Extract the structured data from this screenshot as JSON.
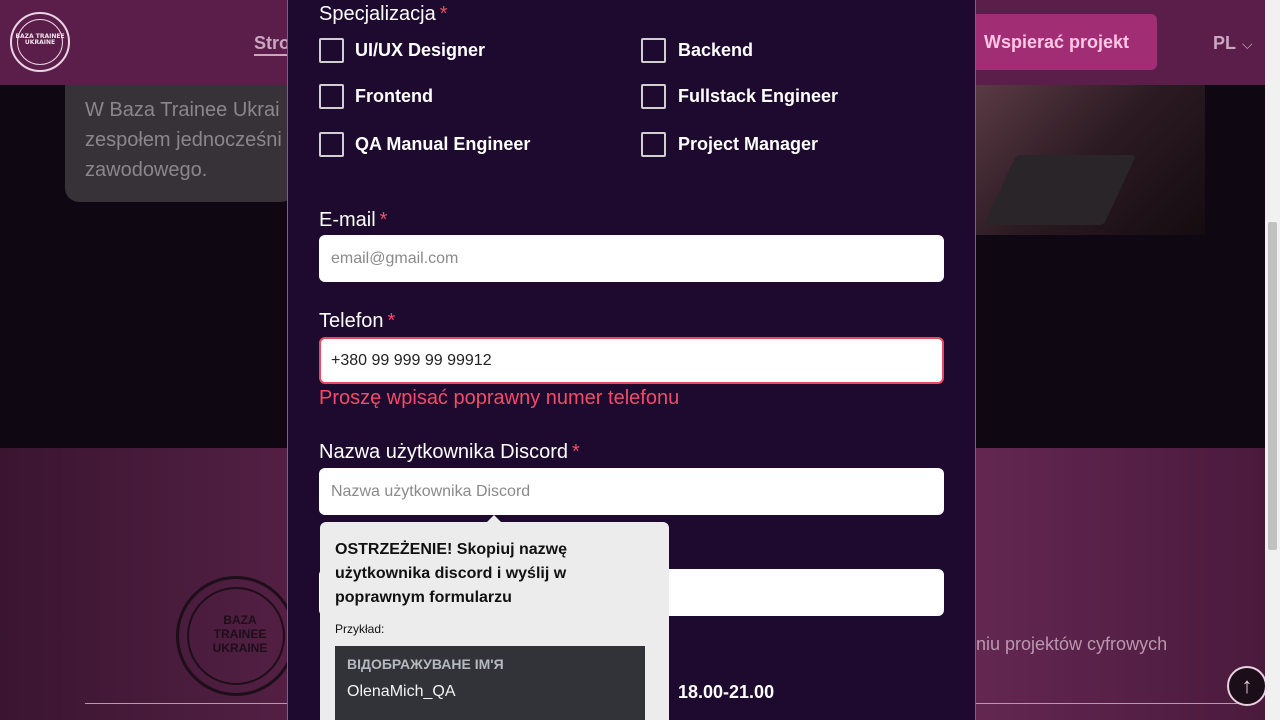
{
  "background": {
    "logo_text": "BAZA TRAINEE UKRAINE",
    "nav_item": "Stro",
    "support_button": "Wspierać projekt",
    "language": "PL",
    "card_text": "W Baza Trainee Ukrai zespołem jednocześni zawodowego.",
    "lower_text": "niu projektów cyfrowych",
    "scroll_top_icon": "arrow-up-icon"
  },
  "form": {
    "specialization_label": "Specjalizacja",
    "required_mark": "*",
    "specializations": [
      "UI/UX Designer",
      "Backend",
      "Frontend",
      "Fullstack Engineer",
      "QA Manual Engineer",
      "Project Manager"
    ],
    "email_label": "E-mail",
    "email_placeholder": "email@gmail.com",
    "phone_label": "Telefon",
    "phone_value": "+380 99 999 99 99912",
    "phone_error": "Proszę wpisać poprawny numer telefonu",
    "discord_label": "Nazwa użytkownika Discord",
    "discord_placeholder": "Nazwa użytkownika Discord",
    "time_option": "18.00-21.00"
  },
  "tooltip": {
    "warning": "OSTRZEŻENIE! Skopiuj nazwę użytkownika discord i wyślij w poprawnym formularzu",
    "example_label": "Przykład:",
    "sample_heading": "ВІДОБРАЖУВАНЕ ІМ'Я",
    "sample_name": "OlenaMich_QA"
  },
  "colors": {
    "modal_bg": "#1d0a2e",
    "accent": "#c23b8e",
    "error": "#f24c67"
  }
}
